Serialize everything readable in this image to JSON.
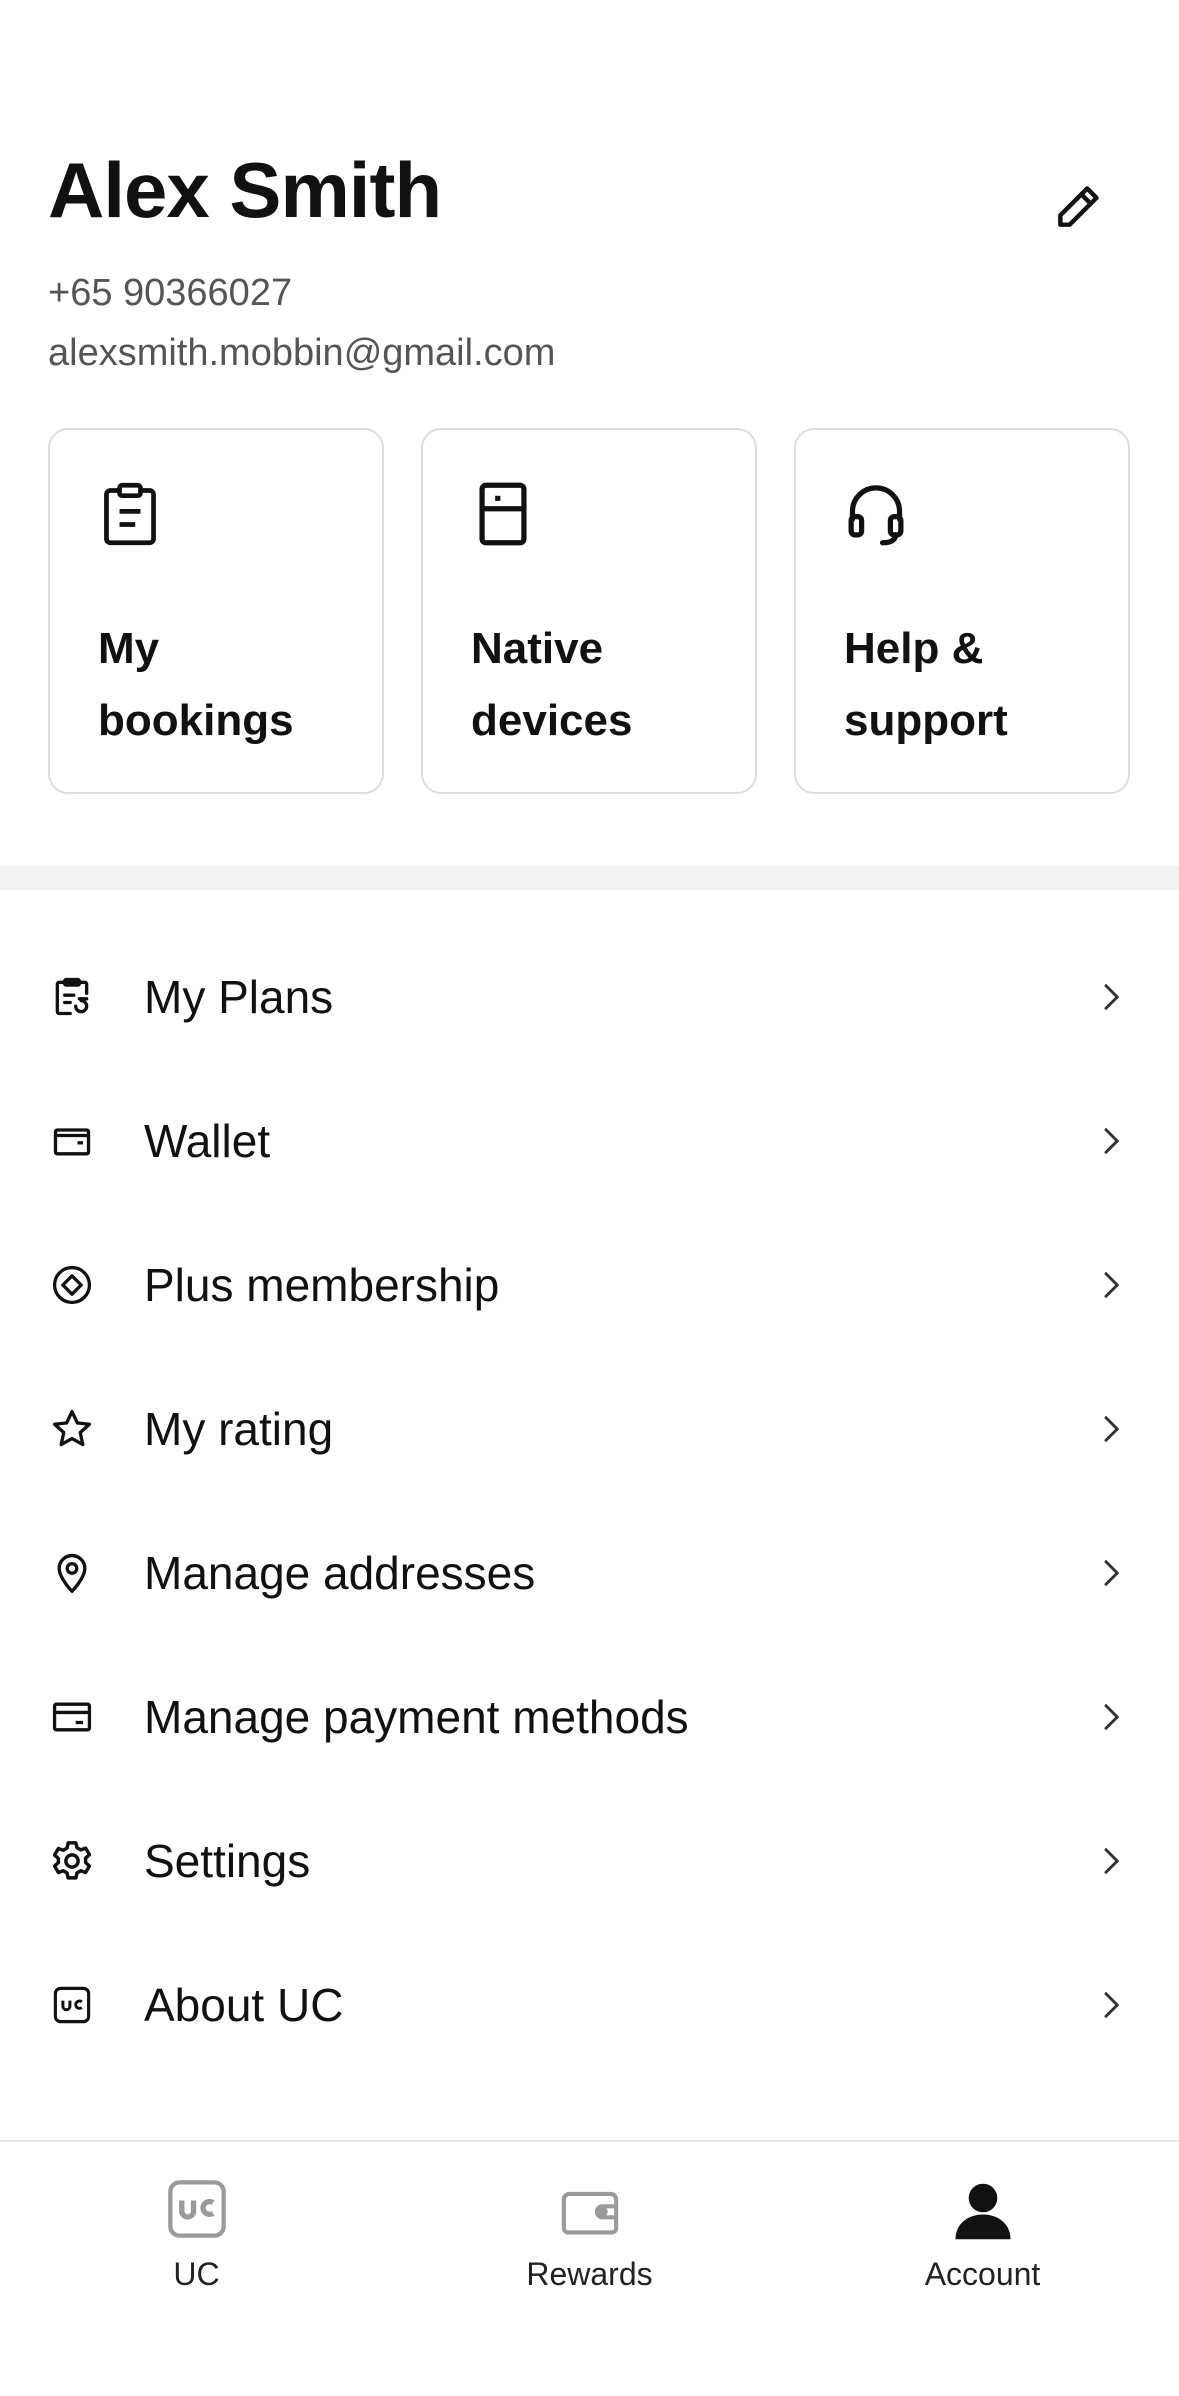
{
  "profile": {
    "name": "Alex Smith",
    "phone": "+65 90366027",
    "email": "alexsmith.mobbin@gmail.com",
    "edit_icon": "pencil-icon"
  },
  "cards": [
    {
      "line1": "My",
      "line2": "bookings",
      "icon": "clipboard-icon"
    },
    {
      "line1": "Native",
      "line2": "devices",
      "icon": "fridge-icon"
    },
    {
      "line1": "Help &",
      "line2": "support",
      "icon": "headset-icon"
    }
  ],
  "menu": [
    {
      "label": "My Plans",
      "icon": "plans-icon"
    },
    {
      "label": "Wallet",
      "icon": "wallet-icon"
    },
    {
      "label": "Plus membership",
      "icon": "membership-icon"
    },
    {
      "label": "My rating",
      "icon": "star-icon"
    },
    {
      "label": "Manage addresses",
      "icon": "location-pin-icon"
    },
    {
      "label": "Manage payment methods",
      "icon": "card-icon"
    },
    {
      "label": "Settings",
      "icon": "gear-icon"
    },
    {
      "label": "About UC",
      "icon": "uc-logo-icon"
    }
  ],
  "bottom_nav": [
    {
      "label": "UC",
      "icon": "uc-logo-icon",
      "active": false
    },
    {
      "label": "Rewards",
      "icon": "wallet-icon",
      "active": false
    },
    {
      "label": "Account",
      "icon": "person-icon",
      "active": true
    }
  ],
  "colors": {
    "text": "#111111",
    "muted": "#555555",
    "border": "#dddddd",
    "inactive_icon": "#9a9a9a"
  }
}
